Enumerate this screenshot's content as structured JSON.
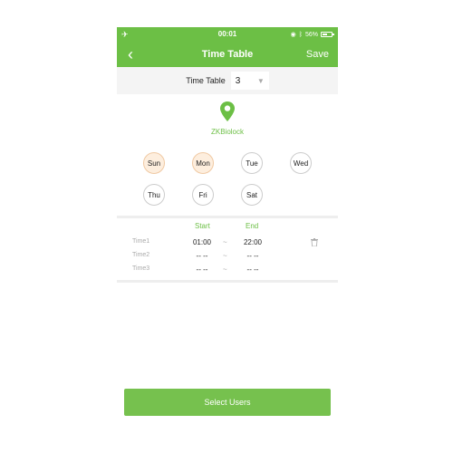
{
  "status_bar": {
    "time": "00:01",
    "battery": "56%",
    "battery_level": 0.56
  },
  "nav": {
    "title": "Time Table",
    "save_label": "Save"
  },
  "time_table": {
    "label": "Time Table",
    "selected_value": "3"
  },
  "lock": {
    "name": "ZKBiolock"
  },
  "days": [
    {
      "label": "Sun",
      "selected": true
    },
    {
      "label": "Mon",
      "selected": true
    },
    {
      "label": "Tue",
      "selected": false
    },
    {
      "label": "Wed",
      "selected": false
    },
    {
      "label": "Thu",
      "selected": false
    },
    {
      "label": "Fri",
      "selected": false
    },
    {
      "label": "Sat",
      "selected": false
    }
  ],
  "schedule": {
    "start_header": "Start",
    "end_header": "End",
    "separator": "~",
    "rows": [
      {
        "label": "Time1",
        "start": "01:00",
        "end": "22:00"
      },
      {
        "label": "Time2",
        "start": "-- --",
        "end": "-- --"
      },
      {
        "label": "Time3",
        "start": "-- --",
        "end": "-- --"
      }
    ]
  },
  "footer": {
    "select_users_label": "Select Users"
  },
  "colors": {
    "accent": "#6cbf45",
    "day_selected_bg": "#fdeede"
  }
}
